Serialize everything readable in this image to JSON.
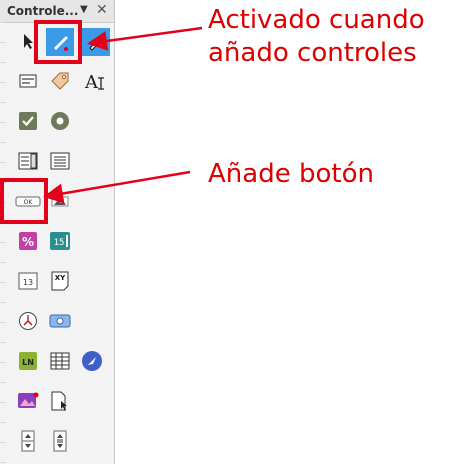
{
  "panel": {
    "title": "Controle...",
    "dropdown_glyph": "▼",
    "close_glyph": "✕"
  },
  "buttons": [
    {
      "name": "select-pointer-icon"
    },
    {
      "name": "design-mode-icon",
      "active": true
    },
    {
      "name": "control-wizards-icon",
      "active": true
    },
    {
      "name": "form-properties-icon"
    },
    {
      "name": "tag-label-icon"
    },
    {
      "name": "text-box-icon"
    },
    {
      "name": "checkbox-icon"
    },
    {
      "name": "option-button-icon"
    },
    {
      "name": "list-box-icon"
    },
    {
      "name": "combo-box-icon"
    },
    {
      "name": "push-button-icon",
      "label": "OK"
    },
    {
      "name": "image-button-icon"
    },
    {
      "name": "formatted-field-icon",
      "label": "%"
    },
    {
      "name": "numeric-field-icon",
      "label": "15"
    },
    {
      "name": "date-field-icon",
      "label": "13"
    },
    {
      "name": "pattern-field-icon",
      "label": "XY"
    },
    {
      "name": "time-field-icon"
    },
    {
      "name": "file-selection-icon"
    },
    {
      "name": "label-field-icon",
      "label": "LN"
    },
    {
      "name": "table-control-icon"
    },
    {
      "name": "navigation-bar-icon"
    },
    {
      "name": "image-control-icon"
    },
    {
      "name": "insert-document-icon"
    },
    {
      "name": "spin-button-icon"
    },
    {
      "name": "scrollbar-icon"
    }
  ],
  "annotations": {
    "activated_line1": "Activado cuando",
    "activated_line2": "añado controles",
    "add_button": "Añade botón"
  },
  "colors": {
    "accent_red": "#e3001b",
    "annotation_text": "#dd0000",
    "active_blue": "#3a9be8"
  }
}
